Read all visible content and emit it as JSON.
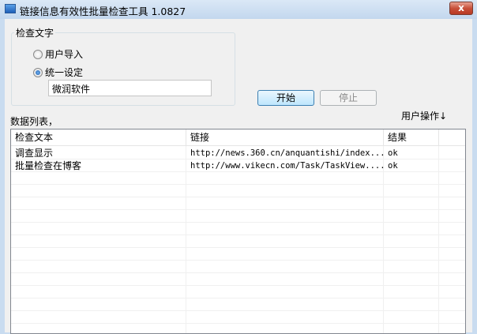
{
  "window": {
    "title": "链接信息有效性批量检查工具 1.0827",
    "close_label": "x"
  },
  "group": {
    "label": "检查文字",
    "radio_import": "用户导入",
    "radio_uniform": "统一设定",
    "uniform_value": "微润软件",
    "selected": "uniform"
  },
  "buttons": {
    "start": "开始",
    "stop": "停止"
  },
  "list": {
    "label": "数据列表，",
    "user_ops": "用户操作↓",
    "columns": [
      "检查文本",
      "链接",
      "结果"
    ],
    "rows": [
      {
        "text": "调查显示",
        "link": "http://news.360.cn/anquantishi/index...",
        "result": "ok"
      },
      {
        "text": "批量检查在博客",
        "link": "http://www.vikecn.com/Task/TaskView....",
        "result": "ok"
      }
    ]
  }
}
